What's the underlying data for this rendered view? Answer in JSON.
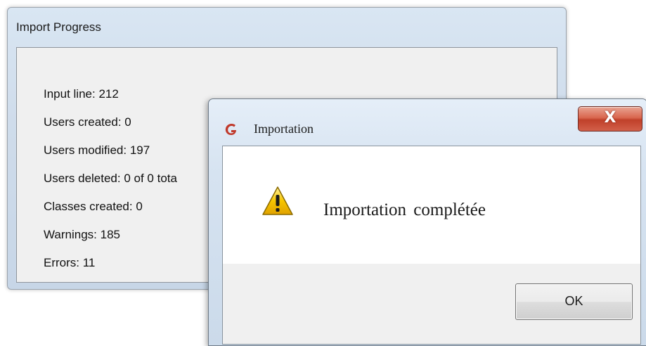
{
  "progress_window": {
    "title": "Import Progress",
    "stats": [
      "Input line: 212",
      "Users created: 0",
      "Users modified: 197",
      "Users deleted: 0 of 0 tota",
      "Classes created: 0",
      "Warnings: 185",
      "Errors: 11"
    ]
  },
  "message_box": {
    "title": "Importation",
    "app_icon": "app-logo-icon",
    "close_glyph": "X",
    "icon": "warning-icon",
    "message": "Importation complétée",
    "ok_label": "OK"
  },
  "colors": {
    "close_button": "#c9452f",
    "warning_fill": "#f7c600",
    "app_logo": "#c0392b"
  }
}
